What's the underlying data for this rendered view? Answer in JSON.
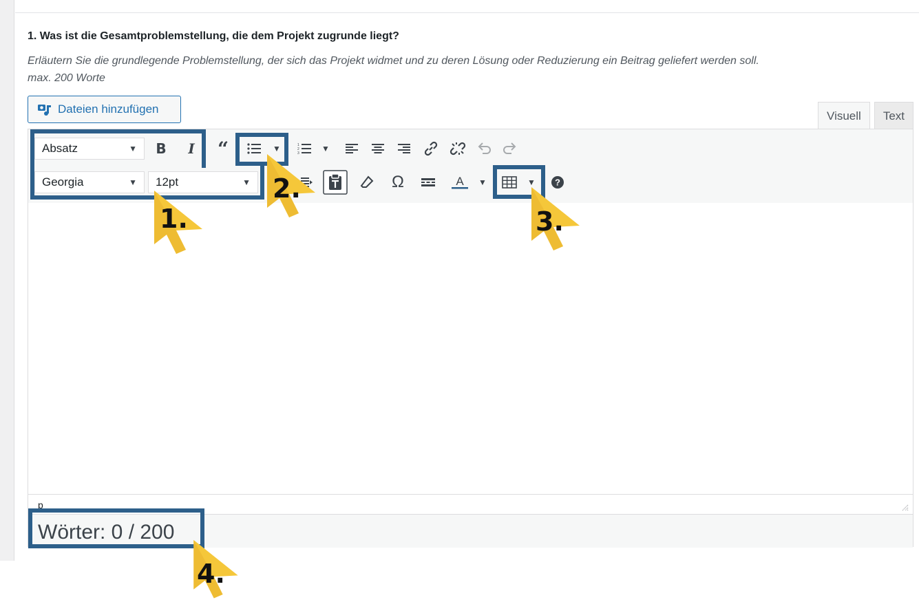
{
  "question": {
    "title": "1. Was ist die Gesamtproblemstellung, die dem Projekt zugrunde liegt?",
    "description_line1": "Erläutern Sie die grundlegende Problemstellung, der sich das Projekt widmet und zu deren Lösung oder Reduzierung ein Beitrag geliefert werden soll.",
    "description_line2": "max. 200 Worte"
  },
  "media_button": {
    "label": "Dateien hinzufügen",
    "icon": "add-media-icon"
  },
  "tabs": [
    {
      "label": "Visuell",
      "active": true
    },
    {
      "label": "Text",
      "active": false
    }
  ],
  "toolbar": {
    "format_select": "Absatz",
    "font_select": "Georgia",
    "size_select": "12pt",
    "icons_row1": [
      "bold",
      "italic",
      "blockquote",
      "bullet-list",
      "bullet-list-dropdown",
      "numbered-list",
      "numbered-list-dropdown",
      "align-left",
      "align-center",
      "align-right",
      "insert-link",
      "remove-link",
      "undo",
      "redo"
    ],
    "icons_row2": [
      "indent",
      "paste-as-text",
      "clear-formatting",
      "special-character",
      "horizontal-line",
      "text-color",
      "text-color-dropdown",
      "table",
      "table-dropdown",
      "help"
    ]
  },
  "statusbar": {
    "path": "p"
  },
  "word_counter": {
    "label": "Wörter: 0 / 200"
  },
  "annotations": [
    "1.",
    "2.",
    "3.",
    "4."
  ],
  "colors": {
    "highlight": "#2d5f8a",
    "arrow": "#f5c73a",
    "accent": "#2271b1"
  }
}
